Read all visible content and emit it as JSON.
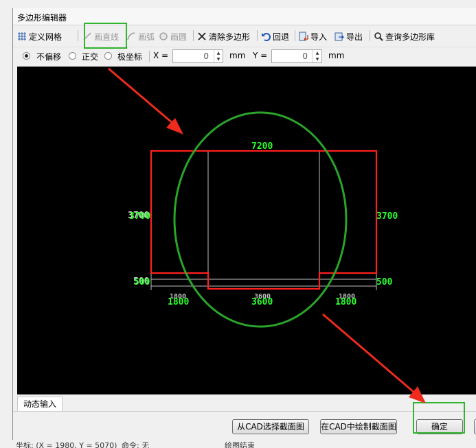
{
  "window": {
    "title": "多边形编辑器"
  },
  "toolbar": {
    "define_grid": "定义网格",
    "draw_line": "画直线",
    "draw_arc": "画弧",
    "draw_circle": "画圆",
    "clear_polygon": "清除多边形",
    "undo": "回退",
    "import": "导入",
    "export": "导出",
    "query_library": "查询多边形库"
  },
  "options": {
    "no_offset": "不偏移",
    "orthogonal": "正交",
    "polar": "极坐标",
    "selected": "不偏移",
    "x_label": "X =",
    "x_value": "0",
    "x_unit": "mm",
    "y_label": "Y =",
    "y_value": "0",
    "y_unit": "mm"
  },
  "drawing": {
    "top_width": "7200",
    "left_height": "3700",
    "left_height_ghost": "3700",
    "right_height": "3700",
    "left_base": "500",
    "left_base_ghost": "500",
    "right_base": "500",
    "seg_left": "1800",
    "seg_mid": "3600",
    "seg_right": "1800",
    "seg_left_small": "1800",
    "seg_mid_small": "3600",
    "seg_right_small": "1800",
    "colors": {
      "shape": "#ff1f1f",
      "dimension": "#2bff2b",
      "guide": "#bfbfbf",
      "annotation_circle": "#2aa52a",
      "arrow": "#ee2b1c"
    }
  },
  "tabs": {
    "dynamic_input": "动态输入"
  },
  "buttons": {
    "select_from_cad": "从CAD选择截面图",
    "draw_in_cad": "在CAD中绘制截面图",
    "ok": "确定"
  },
  "status": {
    "coords": "坐标: (X = 1980, Y = 5070)",
    "command": "命令: 无",
    "message": "绘图结束"
  }
}
